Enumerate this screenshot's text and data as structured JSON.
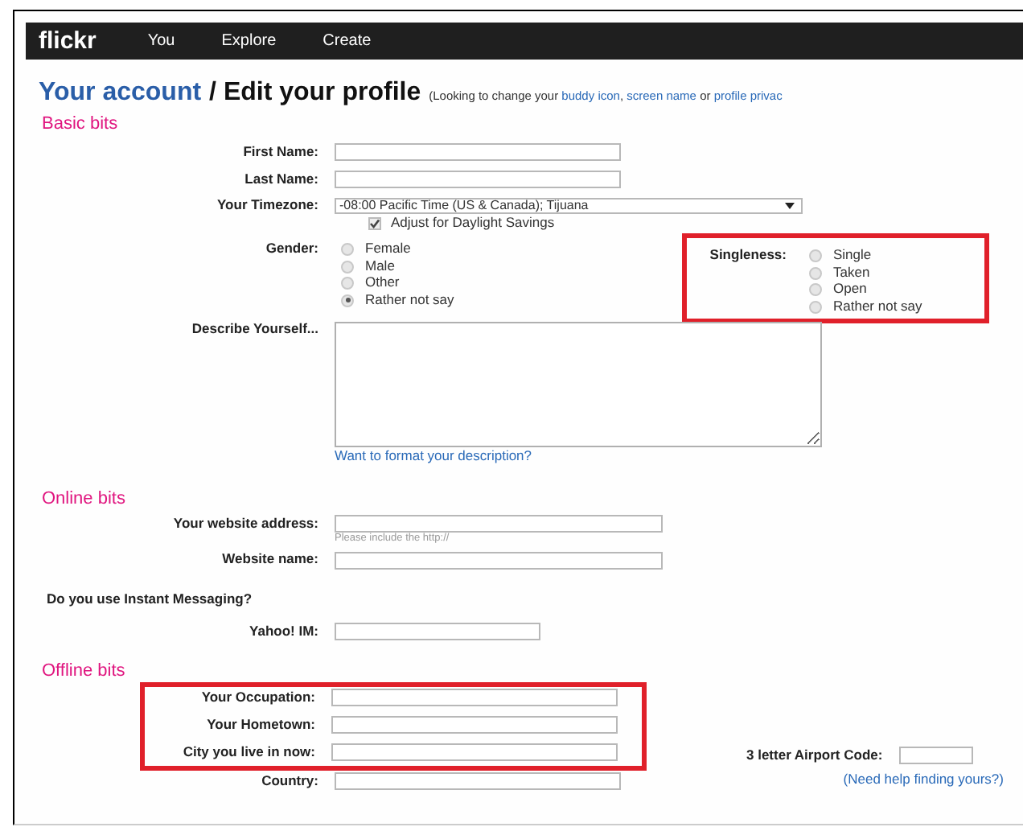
{
  "nav": {
    "logo": "flickr",
    "items": [
      "You",
      "Explore",
      "Create"
    ]
  },
  "heading": {
    "breadcrumb": "Your account",
    "separator": "/",
    "title": "Edit your profile",
    "note": [
      {
        "text": "(Looking to change your ",
        "kind": "text"
      },
      {
        "text": "buddy icon",
        "kind": "link"
      },
      {
        "text": ", ",
        "kind": "text"
      },
      {
        "text": "screen name",
        "kind": "link"
      },
      {
        "text": " or ",
        "kind": "text"
      },
      {
        "text": "profile privac",
        "kind": "link"
      }
    ]
  },
  "basic": {
    "title": "Basic bits",
    "first_name": {
      "label": "First Name:"
    },
    "last_name": {
      "label": "Last Name:"
    },
    "timezone": {
      "label": "Your Timezone:",
      "value": "-08:00 Pacific Time (US & Canada); Tijuana",
      "dst": {
        "label": "Adjust for Daylight Savings",
        "checked": true
      }
    },
    "gender": {
      "label": "Gender:",
      "options": [
        {
          "label": "Female",
          "selected": false
        },
        {
          "label": "Male",
          "selected": false
        },
        {
          "label": "Other",
          "selected": false
        },
        {
          "label": "Rather not say",
          "selected": true
        }
      ]
    },
    "singleness": {
      "label": "Singleness:",
      "highlighted": true,
      "options": [
        {
          "label": "Single",
          "selected": false
        },
        {
          "label": "Taken",
          "selected": false
        },
        {
          "label": "Open",
          "selected": false
        },
        {
          "label": "Rather not say",
          "selected": false
        }
      ]
    },
    "describe": {
      "label": "Describe Yourself...",
      "link": "Want to format your description?"
    }
  },
  "online": {
    "title": "Online bits",
    "website": {
      "label": "Your website address:",
      "hint": "Please include the http://"
    },
    "website_name": {
      "label": "Website name:"
    },
    "im_question": "Do you use Instant Messaging?",
    "yahoo": {
      "label": "Yahoo! IM:"
    }
  },
  "offline": {
    "title": "Offline bits",
    "highlighted": true,
    "fields": [
      {
        "label": "Your Occupation:"
      },
      {
        "label": "Your Hometown:"
      },
      {
        "label": "City you live in now:"
      }
    ],
    "airport": {
      "label": "3 letter Airport Code:",
      "link": "(Need help finding yours?)"
    },
    "country": {
      "label": "Country:"
    }
  }
}
